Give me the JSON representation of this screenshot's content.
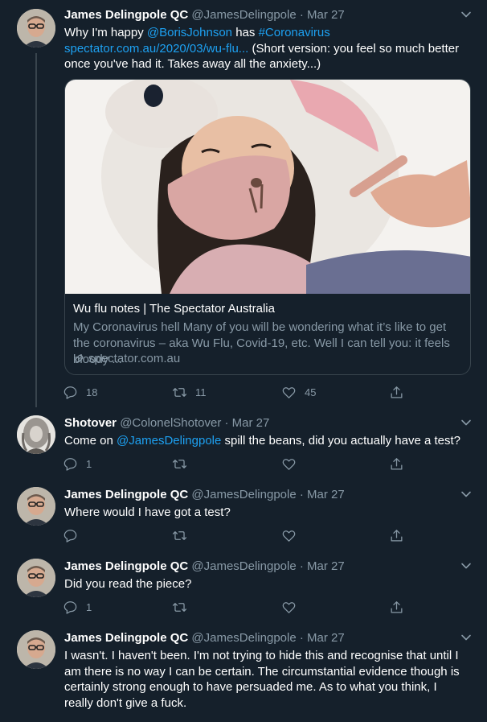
{
  "tweets": [
    {
      "name": "James Delingpole QC",
      "handle": "@JamesDelingpole",
      "date": "Mar 27",
      "text_before": "Why I'm happy ",
      "mention": "@BorisJohnson",
      "text_mid": " has ",
      "hashtag": "#Coronavirus",
      "url": "spectator.com.au/2020/03/wu-flu...",
      "text_after": " (Short version: you feel so much better once you've had it. Takes away all the anxiety...)",
      "card": {
        "title": "Wu flu notes | The Spectator Australia",
        "description": "My Coronavirus hell Many of you will be wondering what it’s like to get the coronavirus – aka Wu Flu, Covid-19, etc. Well I can tell you: it feels bloody ...",
        "domain": "spectator.com.au"
      },
      "replies": "18",
      "retweets": "11",
      "likes": "45"
    },
    {
      "name": "Shotover",
      "handle": "@ColonelShotover",
      "date": "Mar 27",
      "text_before": "Come on ",
      "mention": "@JamesDelingpole",
      "text_after": " spill the beans, did you actually have a test?",
      "replies": "1"
    },
    {
      "name": "James Delingpole QC",
      "handle": "@JamesDelingpole",
      "date": "Mar 27",
      "text": "Where would I have got a test?"
    },
    {
      "name": "James Delingpole QC",
      "handle": "@JamesDelingpole",
      "date": "Mar 27",
      "text": "Did you read the piece?",
      "replies": "1"
    },
    {
      "name": "James Delingpole QC",
      "handle": "@JamesDelingpole",
      "date": "Mar 27",
      "text": "I wasn't. I haven't been. I'm not trying to hide this and recognise that until I am there is no way I can be certain. The circumstantial evidence though is certainly strong enough to have persuaded me. As to what you think, I really don't give a fuck."
    }
  ],
  "separator": "·",
  "colors": {
    "background": "#15202b",
    "text": "#ffffff",
    "muted": "#8899a6",
    "link": "#1da1f2",
    "border": "#38444d"
  },
  "icons": [
    "caret-down-icon",
    "reply-icon",
    "retweet-icon",
    "like-icon",
    "share-icon",
    "link-icon"
  ]
}
